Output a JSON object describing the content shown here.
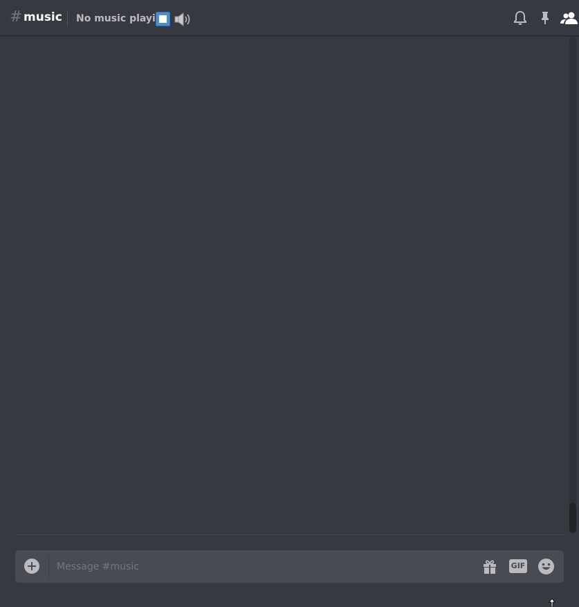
{
  "header": {
    "hash": "#",
    "channel_name": "music",
    "topic": "No music playing",
    "icons": [
      "stop-icon",
      "speaker-icon",
      "bell-icon",
      "pin-icon",
      "members-icon"
    ]
  },
  "composer": {
    "placeholder": "Message #music",
    "gif_label": "GIF",
    "icons": [
      "upload-icon",
      "gift-icon",
      "gif-icon",
      "emoji-icon"
    ]
  },
  "colors": {
    "background": "#36393f",
    "composer": "#484c52",
    "accent": "#4a8fd6",
    "text_muted": "#72767d",
    "icon": "#b9bbbe"
  }
}
